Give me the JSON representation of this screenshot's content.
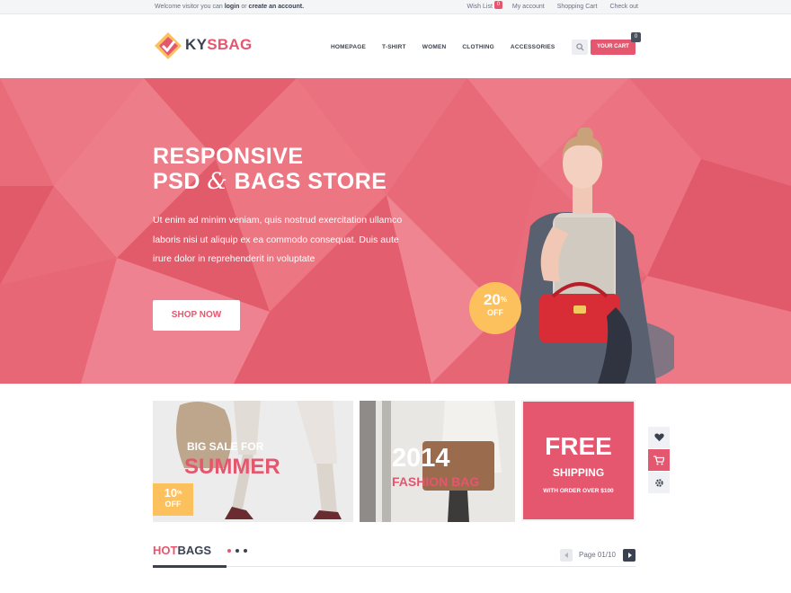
{
  "topbar": {
    "welcome_prefix": "Welcome visitor you can",
    "login": "login",
    "or": "or",
    "create_account": "create an account.",
    "wishlist": "Wish List",
    "wishlist_count": "0",
    "my_account": "My account",
    "shopping_cart": "Shopping Cart",
    "checkout": "Check out"
  },
  "header": {
    "logo_ky": "KY",
    "logo_sbag": "SBAG",
    "nav": [
      "HOMEPAGE",
      "T-SHIRT",
      "WOMEN",
      "CLOTHING",
      "ACCESSORIES"
    ],
    "search_icon": "search-icon",
    "cart_label": "YOUR CART",
    "cart_count": "0"
  },
  "hero": {
    "title_line1": "RESPONSIVE",
    "title_psd": "PSD",
    "title_amp": "&",
    "title_rest": "BAGS STORE",
    "text": "Ut enim ad minim veniam, quis nostrud exercitation ullamco laboris nisi ut aliquip ex ea commodo consequat. Duis aute irure dolor in reprehenderit in voluptate",
    "button": "SHOP NOW",
    "sale_pct": "20",
    "sale_sym": "%",
    "sale_off": "OFF"
  },
  "banners": {
    "b1_line1": "BIG SALE FOR",
    "b1_line2": "SUMMER",
    "b1_pct": "10",
    "b1_sym": "%",
    "b1_off": "OFF",
    "b2_line1": "2014",
    "b2_line2": "FASHION BAG",
    "b3_line1": "FREE",
    "b3_line2": "SHIPPING",
    "b3_line3": "WITH ORDER OVER $100"
  },
  "side_tools": [
    "heart-icon",
    "cart-icon",
    "gear-icon"
  ],
  "hot_bags": {
    "hot": "HOT",
    "bags": "BAGS",
    "pager": "Page 01/10"
  },
  "colors": {
    "accent": "#e5566f",
    "yellow": "#fcc15c",
    "dark": "#3a4150"
  }
}
